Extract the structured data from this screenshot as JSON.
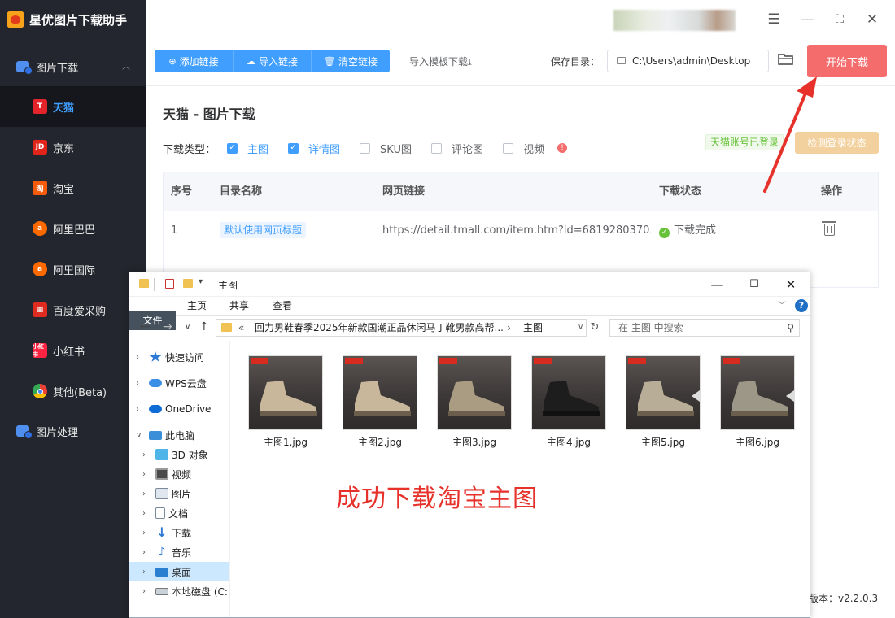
{
  "app": {
    "title": "星优图片下载助手",
    "version": "版本：v2.2.0.3"
  },
  "sidebar": {
    "group_download": "图片下载",
    "group_process": "图片处理",
    "items": [
      {
        "label": "天猫",
        "icon": "T",
        "icon_color": "#e4242a"
      },
      {
        "label": "京东",
        "icon": "JD",
        "icon_color": "#e1251b"
      },
      {
        "label": "淘宝",
        "icon": "淘",
        "icon_color": "#f55b0b"
      },
      {
        "label": "阿里巴巴",
        "icon": "ali",
        "icon_color": "#ff6a00"
      },
      {
        "label": "阿里国际",
        "icon": "ali",
        "icon_color": "#ff6a00"
      },
      {
        "label": "百度爱采购",
        "icon": "grid",
        "icon_color": "#e02b20"
      },
      {
        "label": "小红书",
        "icon": "小红书",
        "icon_color": "#ff2442"
      },
      {
        "label": "其他(Beta)",
        "icon": "chrome",
        "icon_color": "#4285f4"
      }
    ]
  },
  "toolbar": {
    "add_link": "添加链接",
    "import_link": "导入链接",
    "clear_link": "清空链接",
    "template_download": "导入模板下载",
    "save_label": "保存目录：",
    "save_path": "C:\\Users\\admin\\Desktop",
    "start_download": "开始下载"
  },
  "main": {
    "title": "天猫 - 图片下载",
    "download_type_label": "下载类型：",
    "options": [
      {
        "label": "主图",
        "checked": true
      },
      {
        "label": "详情图",
        "checked": true
      },
      {
        "label": "SKU图",
        "checked": false
      },
      {
        "label": "评论图",
        "checked": false
      },
      {
        "label": "视频",
        "checked": false
      }
    ],
    "login_status": "天猫账号已登录",
    "check_login": "检测登录状态",
    "table": {
      "headers": [
        "序号",
        "目录名称",
        "网页链接",
        "下载状态",
        "操作"
      ],
      "rows": [
        {
          "index": "1",
          "dir": "默认使用网页标题",
          "url": "https://detail.tmall.com/item.htm?id=6819280370...",
          "status": "下载完成"
        }
      ]
    }
  },
  "explorer": {
    "title": "主图",
    "ribbon_tabs": [
      "文件",
      "主页",
      "共享",
      "查看"
    ],
    "address_segment_1": "回力男鞋春季2025年新款国潮正品休闲马丁靴男款高帮...",
    "address_segment_2": "主图",
    "search_placeholder": "在 主图 中搜索",
    "tree": [
      {
        "label": "快速访问",
        "icon": "star-icon"
      },
      {
        "label": "WPS云盘",
        "icon": "cloud-icon"
      },
      {
        "label": "OneDrive",
        "icon": "onedrive-icon"
      },
      {
        "label": "此电脑",
        "icon": "pc-icon"
      },
      {
        "label": "3D 对象",
        "icon": "cube-icon"
      },
      {
        "label": "视频",
        "icon": "video-icon"
      },
      {
        "label": "图片",
        "icon": "pictures-icon"
      },
      {
        "label": "文档",
        "icon": "document-icon"
      },
      {
        "label": "下载",
        "icon": "download-icon"
      },
      {
        "label": "音乐",
        "icon": "music-icon"
      },
      {
        "label": "桌面",
        "icon": "desktop-icon"
      },
      {
        "label": "本地磁盘 (C:",
        "icon": "disk-icon"
      }
    ],
    "files": [
      {
        "name": "主图1.jpg",
        "shoe_color": "#c8b79a"
      },
      {
        "name": "主图2.jpg",
        "shoe_color": "#c8b79a"
      },
      {
        "name": "主图3.jpg",
        "shoe_color": "#a99c83"
      },
      {
        "name": "主图4.jpg",
        "shoe_color": "#1d1d1d"
      },
      {
        "name": "主图5.jpg",
        "shoe_color": "#b8ad97"
      },
      {
        "name": "主图6.jpg",
        "shoe_color": "#9d9787"
      }
    ],
    "success_message": "成功下载淘宝主图"
  },
  "colors": {
    "sidebar_bg": "#23262e",
    "primary": "#409eff",
    "danger": "#f56c6c",
    "annotation_red": "#e6322b"
  }
}
